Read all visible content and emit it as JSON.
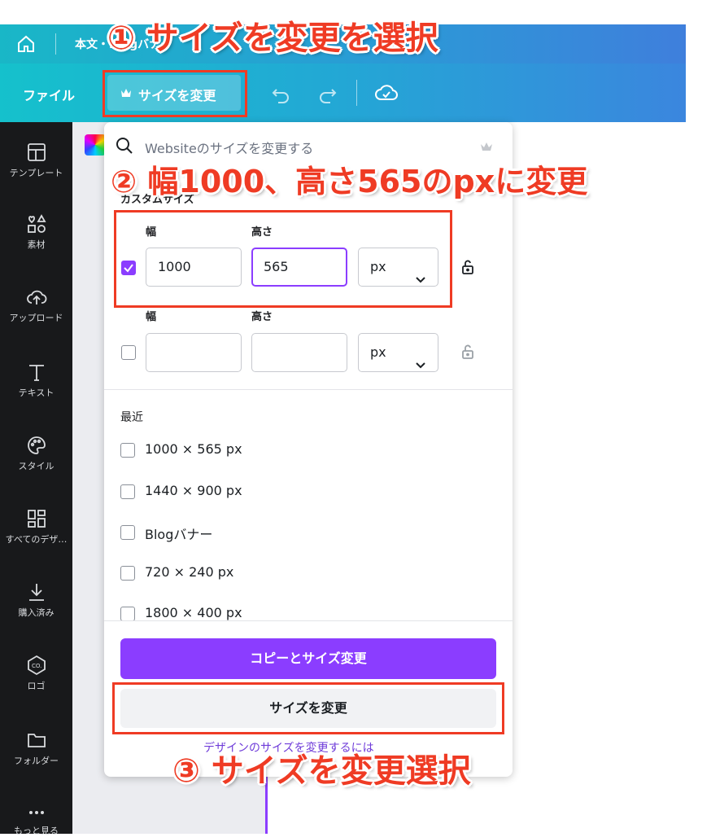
{
  "tabbar": {
    "home_icon": "home-icon",
    "doc_title": "本文・Blogバナー"
  },
  "toolbar": {
    "file_label": "ファイル",
    "resize_label": "サイズを変更",
    "crown_icon": "crown-icon",
    "undo_icon": "undo-icon",
    "redo_icon": "redo-icon",
    "cloud_icon": "cloud-check-icon"
  },
  "sidebar": {
    "items": [
      {
        "label": "テンプレート",
        "icon": "template-icon"
      },
      {
        "label": "素材",
        "icon": "elements-icon"
      },
      {
        "label": "アップロード",
        "icon": "upload-icon"
      },
      {
        "label": "テキスト",
        "icon": "text-icon"
      },
      {
        "label": "スタイル",
        "icon": "palette-icon"
      },
      {
        "label": "すべてのデザ…",
        "icon": "grid-icon"
      },
      {
        "label": "購入済み",
        "icon": "download-icon"
      },
      {
        "label": "ロゴ",
        "icon": "logo-icon"
      },
      {
        "label": "フォルダー",
        "icon": "folder-icon"
      },
      {
        "label": "もっと見る",
        "icon": "more-icon"
      }
    ]
  },
  "resize_panel": {
    "search_placeholder": "Websiteのサイズを変更する",
    "custom_size_label": "カスタムサイズ",
    "row1": {
      "width_label": "幅",
      "height_label": "高さ",
      "width": "1000",
      "height": "565",
      "unit": "px",
      "checked": true
    },
    "row2": {
      "width_label": "幅",
      "height_label": "高さ",
      "width": "",
      "height": "",
      "unit": "px",
      "checked": false
    },
    "recent_label": "最近",
    "recent": [
      "1000 × 565 px",
      "1440 × 900 px",
      "Blogバナー",
      "720 × 240 px",
      "1800 × 400 px"
    ],
    "copy_resize_button": "コピーとサイズ変更",
    "resize_button": "サイズを変更",
    "design_link": "デザインのサイズを変更するには"
  },
  "annotations": {
    "step1": "① サイズを変更を選択",
    "step2": "② 幅1000、高さ565のpxに変更",
    "step3": "③ サイズを変更選択",
    "color": "#ef3b24"
  },
  "colors": {
    "accent": "#8b3dff",
    "annotation": "#ef3b24",
    "sidebar": "#18191b"
  }
}
